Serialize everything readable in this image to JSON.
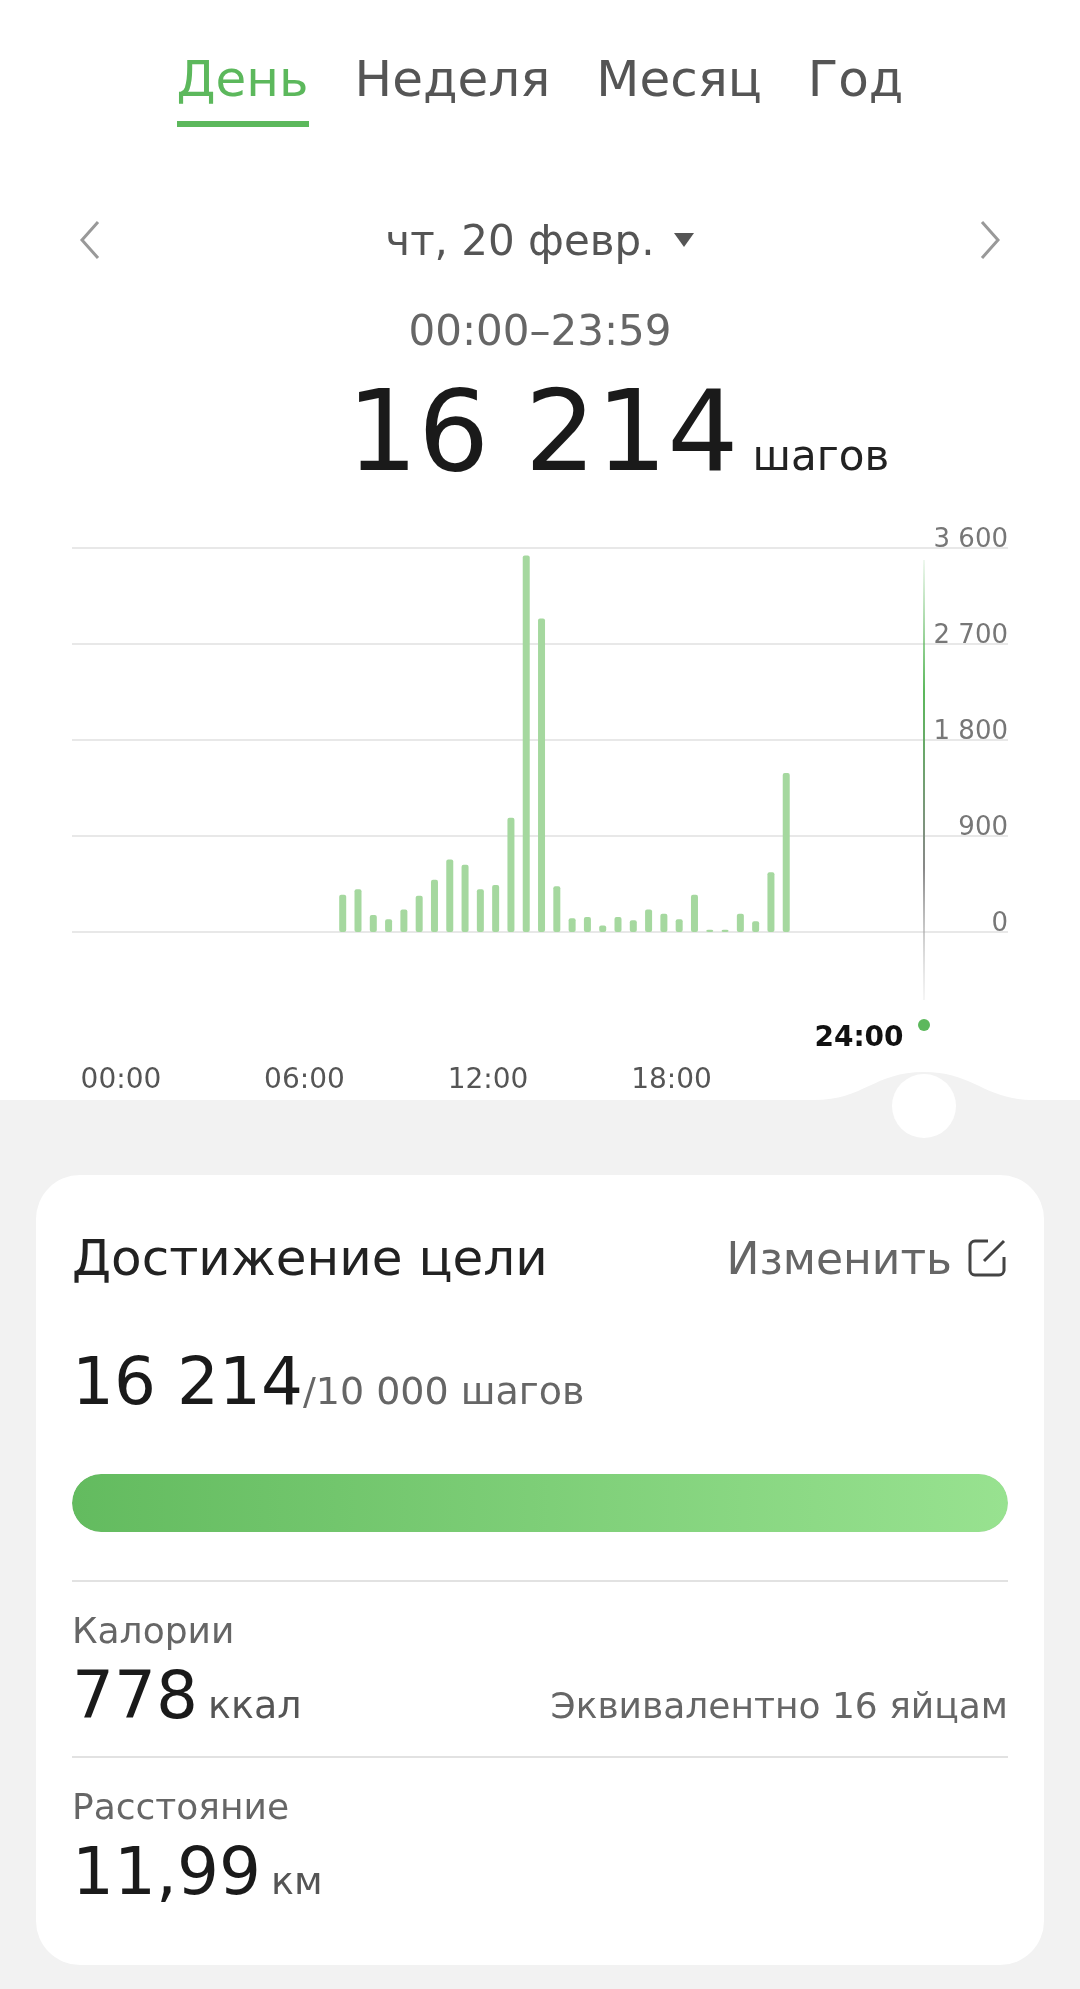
{
  "tabs": [
    {
      "label": "День",
      "selected": true
    },
    {
      "label": "Неделя",
      "selected": false
    },
    {
      "label": "Месяц",
      "selected": false
    },
    {
      "label": "Год",
      "selected": false
    }
  ],
  "date": {
    "label": "чт, 20 февр."
  },
  "time_range": "00:00–23:59",
  "total": {
    "value": "16 214",
    "unit": "шагов"
  },
  "chart": {
    "cursor_label": "24:00",
    "chart_data": {
      "type": "bar",
      "x": [
        7.25,
        7.75,
        8.25,
        8.75,
        9.25,
        9.75,
        10.25,
        10.75,
        11.25,
        11.75,
        12.25,
        12.75,
        13.25,
        13.75,
        14.25,
        14.75,
        15.25,
        15.75,
        16.25,
        16.75,
        17.25,
        17.75,
        18.25,
        18.75,
        19.25,
        19.75,
        20.25,
        20.75,
        21.25,
        21.75
      ],
      "values": [
        350,
        400,
        160,
        120,
        210,
        340,
        490,
        680,
        630,
        400,
        440,
        1070,
        3530,
        2940,
        430,
        130,
        140,
        60,
        140,
        110,
        210,
        170,
        120,
        350,
        20,
        20,
        170,
        100,
        560,
        1490
      ],
      "xlim": [
        -1.6,
        29
      ],
      "ylim": [
        0,
        3600
      ],
      "grid": true,
      "xticks": [
        {
          "value": 0,
          "label": "00:00"
        },
        {
          "value": 6,
          "label": "06:00"
        },
        {
          "value": 12,
          "label": "12:00"
        },
        {
          "value": 18,
          "label": "18:00"
        }
      ],
      "yticks": [
        {
          "value": 0,
          "label": "0"
        },
        {
          "value": 900,
          "label": "900"
        },
        {
          "value": 1800,
          "label": "1 800"
        },
        {
          "value": 2700,
          "label": "2 700"
        },
        {
          "value": 3600,
          "label": "3 600"
        }
      ]
    }
  },
  "goal": {
    "title": "Достижение цели",
    "edit_label": "Изменить",
    "value": "16 214",
    "target": "/10 000 шагов",
    "level": 1
  },
  "stats": [
    {
      "label": "Калории",
      "value": "778",
      "unit": "ккал",
      "note": "Эквивалентно 16 яйцам"
    },
    {
      "label": "Расстояние",
      "value": "11,99",
      "unit": "км"
    }
  ]
}
